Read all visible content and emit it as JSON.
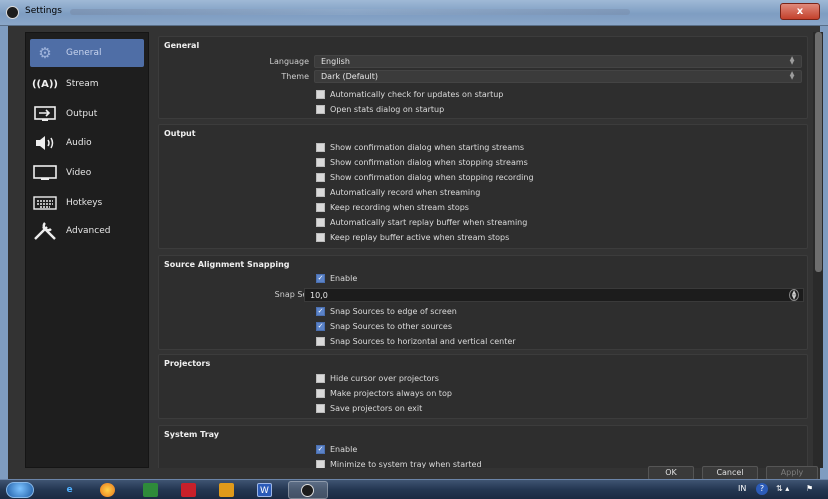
{
  "window": {
    "title": "Settings",
    "close_label": "x"
  },
  "sidebar": {
    "items": [
      {
        "label": "General",
        "icon": "gear-icon",
        "glyph": "⚙",
        "active": true
      },
      {
        "label": "Stream",
        "icon": "antenna-icon",
        "glyph": "((A))",
        "active": false
      },
      {
        "label": "Output",
        "icon": "output-icon",
        "glyph": "⇥",
        "active": false
      },
      {
        "label": "Audio",
        "icon": "speaker-icon",
        "glyph": "🔊",
        "active": false
      },
      {
        "label": "Video",
        "icon": "monitor-icon",
        "glyph": "▭",
        "active": false
      },
      {
        "label": "Hotkeys",
        "icon": "keyboard-icon",
        "glyph": "⌨",
        "active": false
      },
      {
        "label": "Advanced",
        "icon": "wrench-icon",
        "glyph": "✂",
        "active": false
      }
    ]
  },
  "general": {
    "title": "General",
    "language_label": "Language",
    "language_value": "English",
    "theme_label": "Theme",
    "theme_value": "Dark (Default)",
    "check_updates": "Automatically check for updates on startup",
    "open_stats": "Open stats dialog on startup"
  },
  "output": {
    "title": "Output",
    "options": [
      "Show confirmation dialog when starting streams",
      "Show confirmation dialog when stopping streams",
      "Show confirmation dialog when stopping recording",
      "Automatically record when streaming",
      "Keep recording when stream stops",
      "Automatically start replay buffer when streaming",
      "Keep replay buffer active when stream stops"
    ]
  },
  "snapping": {
    "title": "Source Alignment Snapping",
    "enable": "Enable",
    "enable_checked": true,
    "sensitivity_label": "Snap Sensitivity",
    "sensitivity_value": "10,0",
    "options": [
      {
        "label": "Snap Sources to edge of screen",
        "checked": true
      },
      {
        "label": "Snap Sources to other sources",
        "checked": true
      },
      {
        "label": "Snap Sources to horizontal and vertical center",
        "checked": false
      }
    ]
  },
  "projectors": {
    "title": "Projectors",
    "options": [
      "Hide cursor over projectors",
      "Make projectors always on top",
      "Save projectors on exit"
    ]
  },
  "system_tray": {
    "title": "System Tray",
    "enable": "Enable",
    "enable_checked": true,
    "minimize": "Minimize to system tray when started"
  },
  "buttons": {
    "ok": "OK",
    "cancel": "Cancel",
    "apply": "Apply"
  },
  "taskbar": {
    "language": "IN",
    "word_label": "W"
  },
  "colors": {
    "accent": "#4f6ea6",
    "checkbox_checked": "#5b83c8"
  }
}
